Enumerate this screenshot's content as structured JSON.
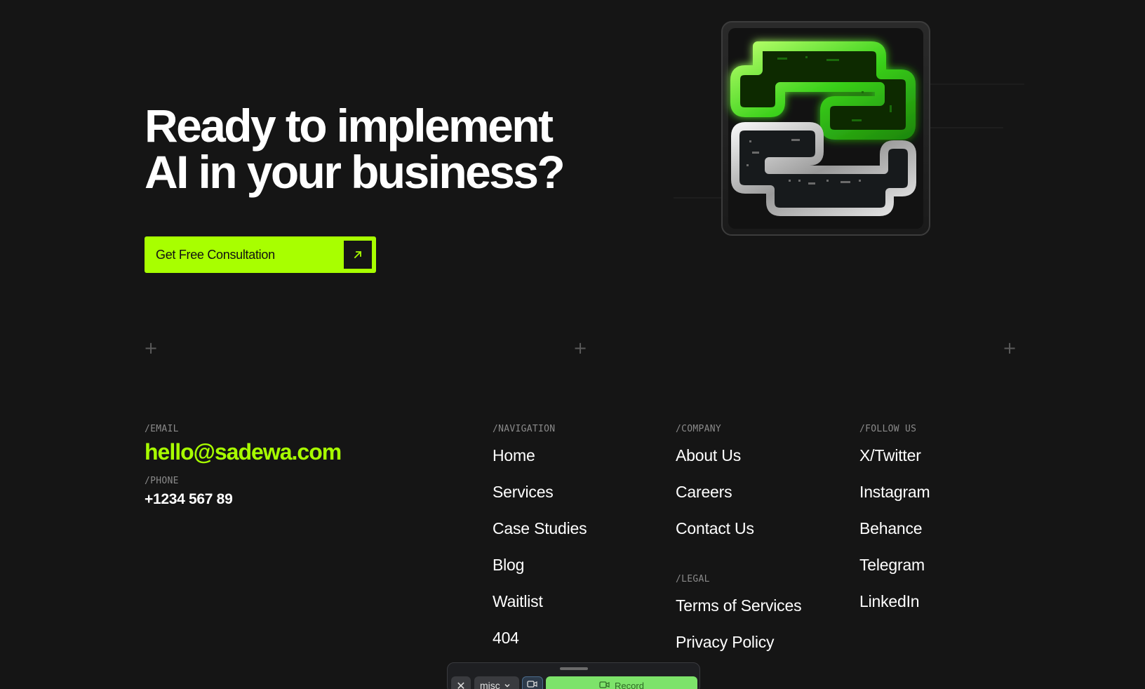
{
  "hero": {
    "title_line1": "Ready to implement",
    "title_line2": "AI in your business?",
    "cta_label": "Get Free Consultation"
  },
  "contact": {
    "email_label": "/EMAIL",
    "email": "hello@sadewa.com",
    "phone_label": "/PHONE",
    "phone": "+1234 567 89"
  },
  "navigation": {
    "label": "/NAVIGATION",
    "items": [
      "Home",
      "Services",
      "Case Studies",
      "Blog",
      "Waitlist",
      "404"
    ]
  },
  "company": {
    "label": "/COMPANY",
    "items": [
      "About Us",
      "Careers",
      "Contact Us"
    ]
  },
  "legal": {
    "label": "/LEGAL",
    "items": [
      "Terms of Services",
      "Privacy Policy"
    ]
  },
  "social": {
    "label": "/FOLLOW US",
    "items": [
      "X/Twitter",
      "Instagram",
      "Behance",
      "Telegram",
      "LinkedIn"
    ]
  },
  "recorder": {
    "select_value": "misc",
    "record_label": "Record"
  },
  "colors": {
    "background": "#151515",
    "accent": "#a8ff00",
    "text": "#ffffff",
    "muted": "#8a8a8a"
  },
  "icons": [
    "arrow-up-right-icon",
    "plus-icon",
    "close-icon",
    "chevron-down-icon",
    "camera-icon"
  ]
}
